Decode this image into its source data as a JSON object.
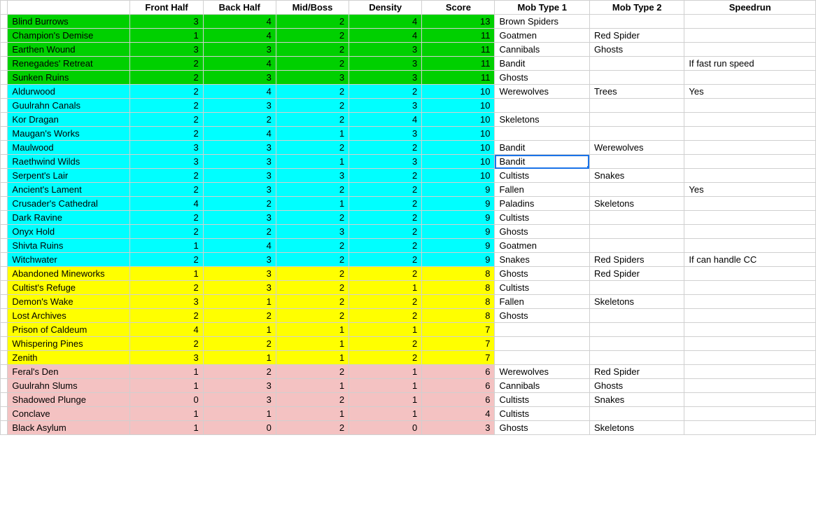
{
  "columns": [
    "Front Half",
    "Back Half",
    "Mid/Boss",
    "Density",
    "Score",
    "Mob Type 1",
    "Mob Type 2",
    "Speedrun"
  ],
  "selected": {
    "row": 10,
    "col_index": 6
  },
  "colors": {
    "green": "#00d000",
    "cyan": "#00ffff",
    "yellow": "#ffff00",
    "pink": "#f4c2c2"
  },
  "rows": [
    {
      "name": "Blind Burrows",
      "front_half": 3,
      "back_half": 4,
      "mid_boss": 2,
      "density": 4,
      "score": 13,
      "mob1": "Brown Spiders",
      "mob2": "",
      "speedrun": "",
      "color": "green",
      "color_cols": 6
    },
    {
      "name": "Champion's Demise",
      "front_half": 1,
      "back_half": 4,
      "mid_boss": 2,
      "density": 4,
      "score": 11,
      "mob1": "Goatmen",
      "mob2": "Red Spider",
      "speedrun": "",
      "color": "green",
      "color_cols": 6
    },
    {
      "name": "Earthen Wound",
      "front_half": 3,
      "back_half": 3,
      "mid_boss": 2,
      "density": 3,
      "score": 11,
      "mob1": "Cannibals",
      "mob2": "Ghosts",
      "speedrun": "",
      "color": "green",
      "color_cols": 6
    },
    {
      "name": "Renegades' Retreat",
      "front_half": 2,
      "back_half": 4,
      "mid_boss": 2,
      "density": 3,
      "score": 11,
      "mob1": "Bandit",
      "mob2": "",
      "speedrun": "If fast run speed",
      "color": "green",
      "color_cols": 6
    },
    {
      "name": "Sunken Ruins",
      "front_half": 2,
      "back_half": 3,
      "mid_boss": 3,
      "density": 3,
      "score": 11,
      "mob1": "Ghosts",
      "mob2": "",
      "speedrun": "",
      "color": "green",
      "color_cols": 6
    },
    {
      "name": "Aldurwood",
      "front_half": 2,
      "back_half": 4,
      "mid_boss": 2,
      "density": 2,
      "score": 10,
      "mob1": "Werewolves",
      "mob2": "Trees",
      "speedrun": "Yes",
      "color": "cyan",
      "color_cols": 6
    },
    {
      "name": "Guulrahn Canals",
      "front_half": 2,
      "back_half": 3,
      "mid_boss": 2,
      "density": 3,
      "score": 10,
      "mob1": "",
      "mob2": "",
      "speedrun": "",
      "color": "cyan",
      "color_cols": 6
    },
    {
      "name": "Kor Dragan",
      "front_half": 2,
      "back_half": 2,
      "mid_boss": 2,
      "density": 4,
      "score": 10,
      "mob1": "Skeletons",
      "mob2": "",
      "speedrun": "",
      "color": "cyan",
      "color_cols": 6
    },
    {
      "name": "Maugan's Works",
      "front_half": 2,
      "back_half": 4,
      "mid_boss": 1,
      "density": 3,
      "score": 10,
      "mob1": "",
      "mob2": "",
      "speedrun": "",
      "color": "cyan",
      "color_cols": 6
    },
    {
      "name": "Maulwood",
      "front_half": 3,
      "back_half": 3,
      "mid_boss": 2,
      "density": 2,
      "score": 10,
      "mob1": "Bandit",
      "mob2": "Werewolves",
      "speedrun": "",
      "color": "cyan",
      "color_cols": 6
    },
    {
      "name": "Raethwind Wilds",
      "front_half": 3,
      "back_half": 3,
      "mid_boss": 1,
      "density": 3,
      "score": 10,
      "mob1": "Bandit",
      "mob2": "",
      "speedrun": "",
      "color": "cyan",
      "color_cols": 6
    },
    {
      "name": "Serpent's Lair",
      "front_half": 2,
      "back_half": 3,
      "mid_boss": 3,
      "density": 2,
      "score": 10,
      "mob1": "Cultists",
      "mob2": "Snakes",
      "speedrun": "",
      "color": "cyan",
      "color_cols": 6
    },
    {
      "name": "Ancient's Lament",
      "front_half": 2,
      "back_half": 3,
      "mid_boss": 2,
      "density": 2,
      "score": 9,
      "mob1": "Fallen",
      "mob2": "",
      "speedrun": "Yes",
      "color": "cyan",
      "color_cols": 6
    },
    {
      "name": "Crusader's Cathedral",
      "front_half": 4,
      "back_half": 2,
      "mid_boss": 1,
      "density": 2,
      "score": 9,
      "mob1": "Paladins",
      "mob2": "Skeletons",
      "speedrun": "",
      "color": "cyan",
      "color_cols": 6
    },
    {
      "name": "Dark Ravine",
      "front_half": 2,
      "back_half": 3,
      "mid_boss": 2,
      "density": 2,
      "score": 9,
      "mob1": "Cultists",
      "mob2": "",
      "speedrun": "",
      "color": "cyan",
      "color_cols": 6
    },
    {
      "name": "Onyx Hold",
      "front_half": 2,
      "back_half": 2,
      "mid_boss": 3,
      "density": 2,
      "score": 9,
      "mob1": "Ghosts",
      "mob2": "",
      "speedrun": "",
      "color": "cyan",
      "color_cols": 6
    },
    {
      "name": "Shivta Ruins",
      "front_half": 1,
      "back_half": 4,
      "mid_boss": 2,
      "density": 2,
      "score": 9,
      "mob1": "Goatmen",
      "mob2": "",
      "speedrun": "",
      "color": "cyan",
      "color_cols": 6
    },
    {
      "name": "Witchwater",
      "front_half": 2,
      "back_half": 3,
      "mid_boss": 2,
      "density": 2,
      "score": 9,
      "mob1": "Snakes",
      "mob2": "Red Spiders",
      "speedrun": "If can handle CC",
      "color": "cyan",
      "color_cols": 6
    },
    {
      "name": "Abandoned Mineworks",
      "front_half": 1,
      "back_half": 3,
      "mid_boss": 2,
      "density": 2,
      "score": 8,
      "mob1": "Ghosts",
      "mob2": "Red Spider",
      "speedrun": "",
      "color": "yellow",
      "color_cols": 6
    },
    {
      "name": "Cultist's Refuge",
      "front_half": 2,
      "back_half": 3,
      "mid_boss": 2,
      "density": 1,
      "score": 8,
      "mob1": "Cultists",
      "mob2": "",
      "speedrun": "",
      "color": "yellow",
      "color_cols": 6
    },
    {
      "name": "Demon's Wake",
      "front_half": 3,
      "back_half": 1,
      "mid_boss": 2,
      "density": 2,
      "score": 8,
      "mob1": "Fallen",
      "mob2": "Skeletons",
      "speedrun": "",
      "color": "yellow",
      "color_cols": 6
    },
    {
      "name": "Lost Archives",
      "front_half": 2,
      "back_half": 2,
      "mid_boss": 2,
      "density": 2,
      "score": 8,
      "mob1": "Ghosts",
      "mob2": "",
      "speedrun": "",
      "color": "yellow",
      "color_cols": 6
    },
    {
      "name": "Prison of Caldeum",
      "front_half": 4,
      "back_half": 1,
      "mid_boss": 1,
      "density": 1,
      "score": 7,
      "mob1": "",
      "mob2": "",
      "speedrun": "",
      "color": "yellow",
      "color_cols": 6
    },
    {
      "name": "Whispering Pines",
      "front_half": 2,
      "back_half": 2,
      "mid_boss": 1,
      "density": 2,
      "score": 7,
      "mob1": "",
      "mob2": "",
      "speedrun": "",
      "color": "yellow",
      "color_cols": 6
    },
    {
      "name": "Zenith",
      "front_half": 3,
      "back_half": 1,
      "mid_boss": 1,
      "density": 2,
      "score": 7,
      "mob1": "",
      "mob2": "",
      "speedrun": "",
      "color": "yellow",
      "color_cols": 6
    },
    {
      "name": "Feral's Den",
      "front_half": 1,
      "back_half": 2,
      "mid_boss": 2,
      "density": 1,
      "score": 6,
      "mob1": "Werewolves",
      "mob2": "Red Spider",
      "speedrun": "",
      "color": "pink",
      "color_cols": 6
    },
    {
      "name": "Guulrahn Slums",
      "front_half": 1,
      "back_half": 3,
      "mid_boss": 1,
      "density": 1,
      "score": 6,
      "mob1": "Cannibals",
      "mob2": "Ghosts",
      "speedrun": "",
      "color": "pink",
      "color_cols": 6
    },
    {
      "name": "Shadowed Plunge",
      "front_half": 0,
      "back_half": 3,
      "mid_boss": 2,
      "density": 1,
      "score": 6,
      "mob1": "Cultists",
      "mob2": "Snakes",
      "speedrun": "",
      "color": "pink",
      "color_cols": 6
    },
    {
      "name": "Conclave",
      "front_half": 1,
      "back_half": 1,
      "mid_boss": 1,
      "density": 1,
      "score": 4,
      "mob1": "Cultists",
      "mob2": "",
      "speedrun": "",
      "color": "pink",
      "color_cols": 6
    },
    {
      "name": "Black Asylum",
      "front_half": 1,
      "back_half": 0,
      "mid_boss": 2,
      "density": 0,
      "score": 3,
      "mob1": "Ghosts",
      "mob2": "Skeletons",
      "speedrun": "",
      "color": "pink",
      "color_cols": 6
    }
  ]
}
